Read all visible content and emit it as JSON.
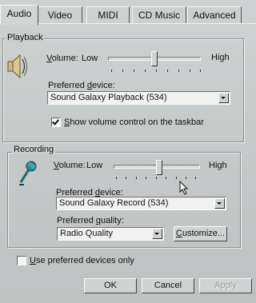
{
  "tabs": [
    {
      "label": "Audio",
      "active": true
    },
    {
      "label": "Video",
      "active": false
    },
    {
      "label": "MIDI",
      "active": false
    },
    {
      "label": "CD Music",
      "active": false
    },
    {
      "label": "Advanced",
      "active": false
    }
  ],
  "playback": {
    "group_title": "Playback",
    "icon": "speaker-icon",
    "volume_label": "Volume:",
    "low_label": "Low",
    "high_label": "High",
    "volume_level": 0.5,
    "device_label": "Preferred device:",
    "device_value": "Sound Galaxy Playback (534)",
    "show_volume_checked": true,
    "show_volume_label": "Show volume control on the taskbar"
  },
  "recording": {
    "group_title": "Recording",
    "icon": "microphone-icon",
    "volume_label": "Volume:",
    "low_label": "Low",
    "high_label": "High",
    "volume_level": 0.55,
    "device_label": "Preferred device:",
    "device_value": "Sound Galaxy Record (534)",
    "quality_label": "Preferred quality:",
    "quality_value": "Radio Quality",
    "customize_label": "Customize..."
  },
  "use_preferred": {
    "checked": false,
    "label": "Use preferred devices only"
  },
  "buttons": {
    "ok": "OK",
    "cancel": "Cancel",
    "apply": "Apply"
  },
  "colors": {
    "dialog_bg": "#c7caca",
    "field_bg": "#f1f2f0"
  }
}
